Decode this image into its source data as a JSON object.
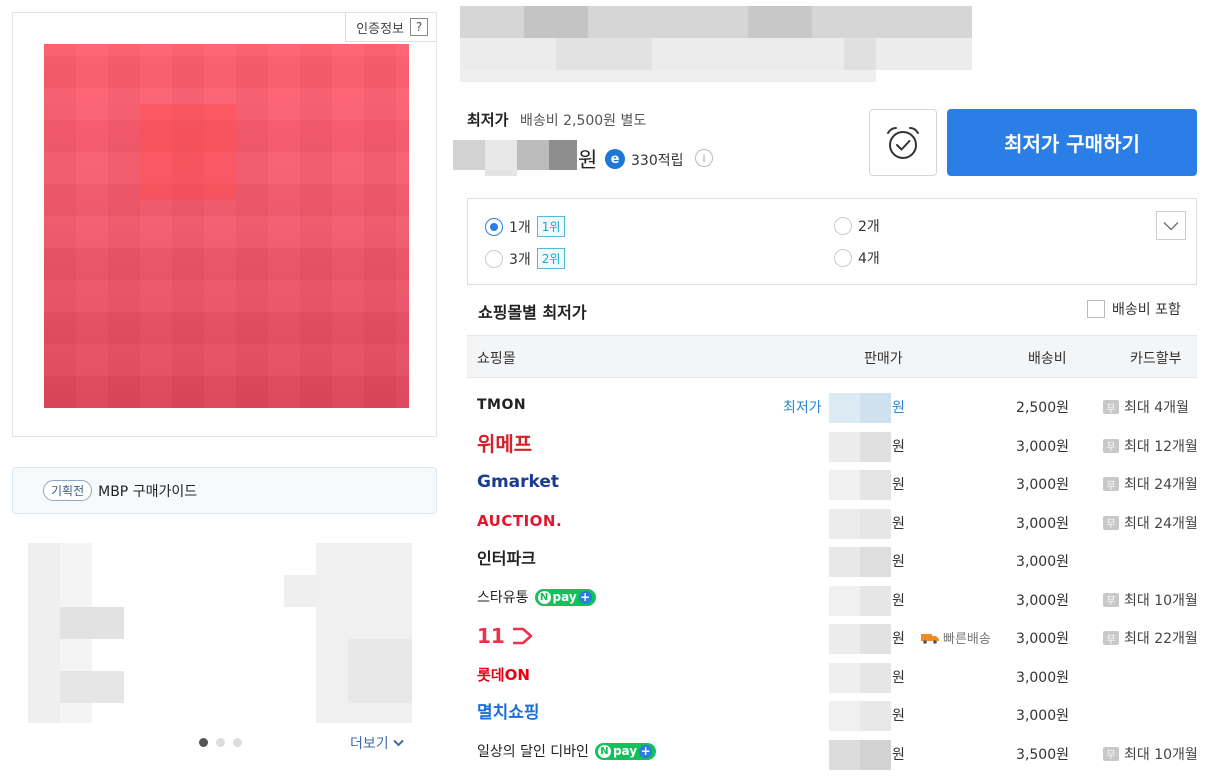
{
  "product": {
    "cert_label": "인증정보",
    "cert_help": "?"
  },
  "promo": {
    "tag": "기획전",
    "text": "MBP 구매가이드"
  },
  "banner": {
    "more_label": "더보기",
    "slides_total": 3,
    "slide_active": 1
  },
  "price": {
    "label": "최저가",
    "shipping_note": "배송비 2,500원 별도",
    "currency": "원",
    "points_icon": "e",
    "points": "330적립",
    "info_icon": "i"
  },
  "actions": {
    "buy_label": "최저가 구매하기",
    "alarm_icon": "alarm-clock-check-icon"
  },
  "quantity_options": [
    {
      "label": "1개",
      "rank": "1위",
      "selected": true
    },
    {
      "label": "2개",
      "rank": "",
      "selected": false
    },
    {
      "label": "3개",
      "rank": "2위",
      "selected": false
    },
    {
      "label": "4개",
      "rank": "",
      "selected": false
    }
  ],
  "mall_section": {
    "title": "쇼핑몰별 최저가",
    "include_shipping_label": "배송비 포함",
    "include_shipping_checked": false,
    "columns": [
      "쇼핑몰",
      "판매가",
      "배송비",
      "카드할부"
    ]
  },
  "mall_rows": [
    {
      "mall": "TMON",
      "lowest_tag": "최저가",
      "won": "원",
      "fast": "",
      "shipping": "2,500원",
      "card_icon": "무",
      "card": "최대 4개월",
      "npay": false
    },
    {
      "mall": "위메프",
      "lowest_tag": "",
      "won": "원",
      "fast": "",
      "shipping": "3,000원",
      "card_icon": "무",
      "card": "최대 12개월",
      "npay": false
    },
    {
      "mall": "Gmarket",
      "lowest_tag": "",
      "won": "원",
      "fast": "",
      "shipping": "3,000원",
      "card_icon": "무",
      "card": "최대 24개월",
      "npay": false
    },
    {
      "mall": "AUCTION.",
      "lowest_tag": "",
      "won": "원",
      "fast": "",
      "shipping": "3,000원",
      "card_icon": "무",
      "card": "최대 24개월",
      "npay": false
    },
    {
      "mall": "인터파크",
      "lowest_tag": "",
      "won": "원",
      "fast": "",
      "shipping": "3,000원",
      "card_icon": "",
      "card": "",
      "npay": false
    },
    {
      "mall": "스타유통",
      "lowest_tag": "",
      "won": "원",
      "fast": "",
      "shipping": "3,000원",
      "card_icon": "무",
      "card": "최대 10개월",
      "npay": true
    },
    {
      "mall": "11",
      "lowest_tag": "",
      "won": "원",
      "fast": "빠른배송",
      "shipping": "3,000원",
      "card_icon": "무",
      "card": "최대 22개월",
      "npay": false
    },
    {
      "mall": "롯데ON",
      "lowest_tag": "",
      "won": "원",
      "fast": "",
      "shipping": "3,000원",
      "card_icon": "",
      "card": "",
      "npay": false
    },
    {
      "mall": "멸치쇼핑",
      "lowest_tag": "",
      "won": "원",
      "fast": "",
      "shipping": "3,000원",
      "card_icon": "",
      "card": "",
      "npay": false
    },
    {
      "mall": "일상의 달인 디바인",
      "lowest_tag": "",
      "won": "원",
      "fast": "",
      "shipping": "3,500원",
      "card_icon": "무",
      "card": "최대 10개월",
      "npay": true
    }
  ],
  "npay_label": "pay",
  "colors": {
    "accent": "#2b7ee6",
    "tmon": "#222222",
    "wemakeprice": "#d6202c",
    "gmarket_g": "#10b24c",
    "gmarket_text": "#1b3b8f",
    "auction": "#e2172c",
    "st11": "#f0304a",
    "lotteon": "#e60012",
    "myulchi": "#1b6fd6",
    "npay": "#11c15a"
  }
}
